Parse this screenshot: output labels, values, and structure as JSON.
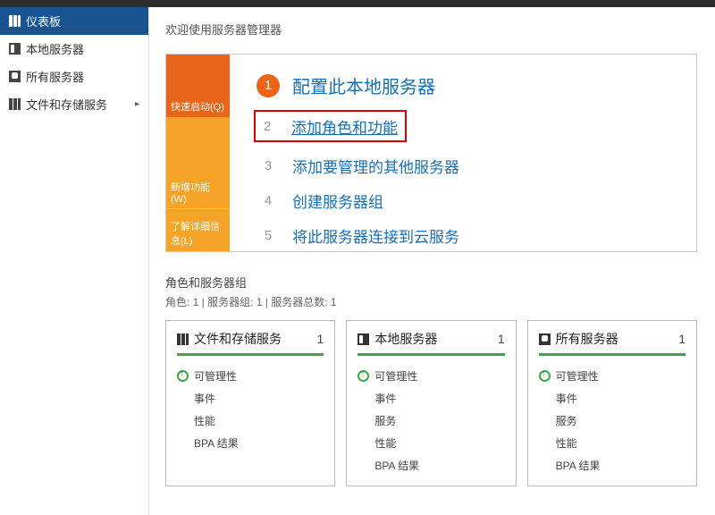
{
  "sidebar": {
    "items": [
      {
        "label": "仪表板"
      },
      {
        "label": "本地服务器"
      },
      {
        "label": "所有服务器"
      },
      {
        "label": "文件和存储服务"
      }
    ]
  },
  "main": {
    "welcome": "欢迎使用服务器管理器",
    "tabs": {
      "quick": "快速启动(Q)",
      "new": "新增功能(W)",
      "learn": "了解详细信息(L)"
    },
    "steps": [
      {
        "num": "1",
        "label": "配置此本地服务器"
      },
      {
        "num": "2",
        "label": "添加角色和功能"
      },
      {
        "num": "3",
        "label": "添加要管理的其他服务器"
      },
      {
        "num": "4",
        "label": "创建服务器组"
      },
      {
        "num": "5",
        "label": "将此服务器连接到云服务"
      }
    ],
    "roles": {
      "title": "角色和服务器组",
      "sub": "角色: 1 | 服务器组: 1 | 服务器总数: 1"
    },
    "tiles": [
      {
        "title": "文件和存储服务",
        "count": "1",
        "rows": [
          "可管理性",
          "事件",
          "性能",
          "BPA 结果"
        ]
      },
      {
        "title": "本地服务器",
        "count": "1",
        "rows": [
          "可管理性",
          "事件",
          "服务",
          "性能",
          "BPA 结果"
        ]
      },
      {
        "title": "所有服务器",
        "count": "1",
        "rows": [
          "可管理性",
          "事件",
          "服务",
          "性能",
          "BPA 结果"
        ]
      }
    ]
  }
}
